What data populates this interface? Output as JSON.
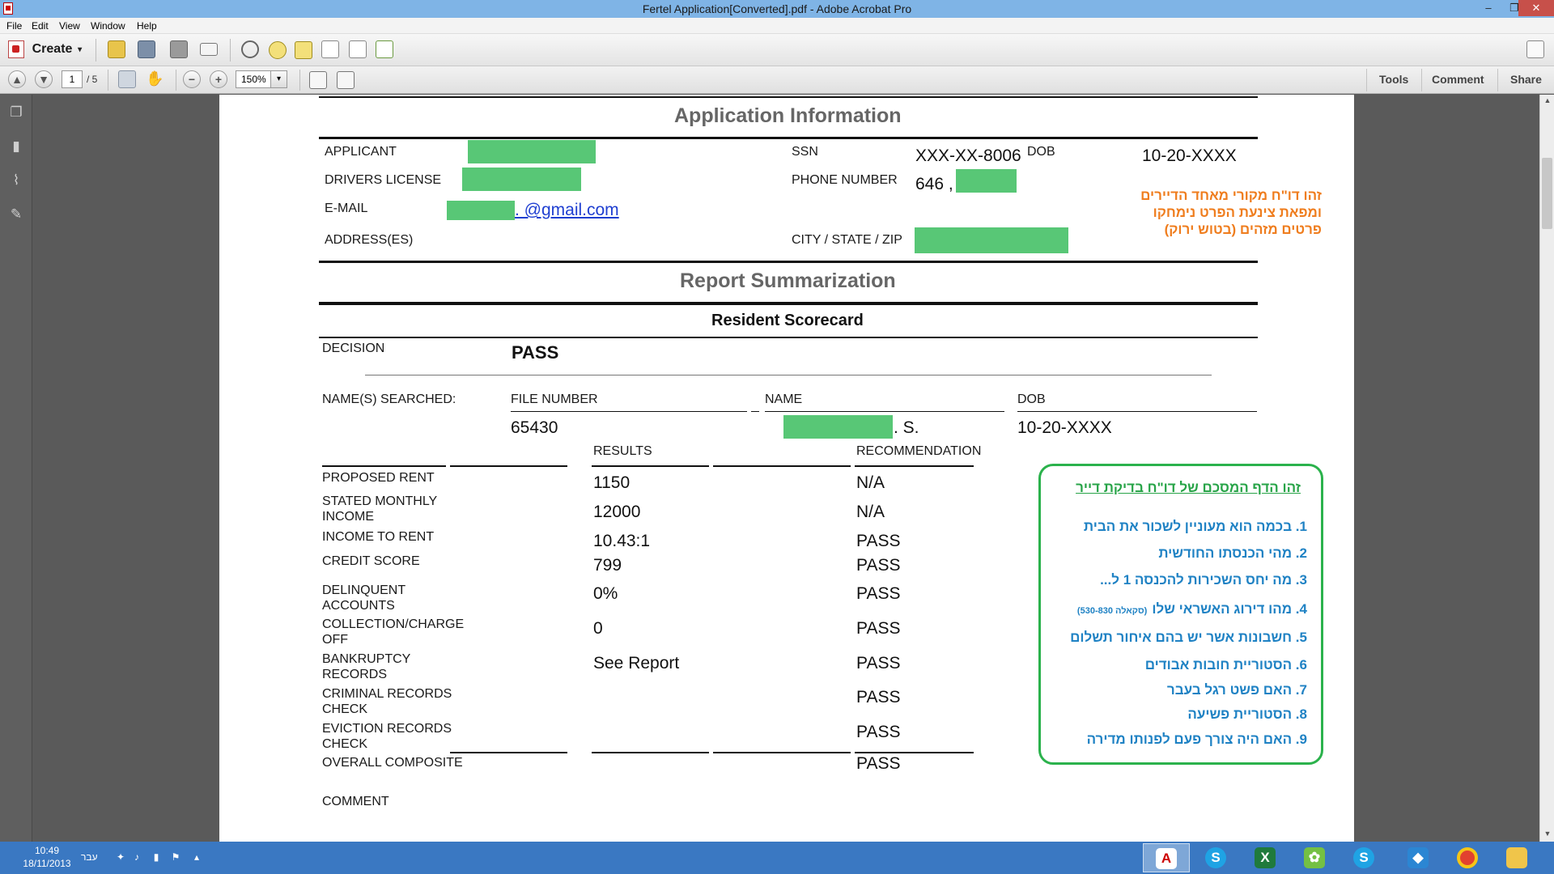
{
  "window": {
    "title": "Fertel Application[Converted].pdf - Adobe Acrobat Pro",
    "controls": {
      "minimize": "–",
      "restore": "❐",
      "close": "✕"
    }
  },
  "menu": [
    "File",
    "Edit",
    "View",
    "Window",
    "Help"
  ],
  "toolbar": {
    "create_label": "Create",
    "create_arrow": "▾",
    "page_current": "1",
    "page_total": "/ 5",
    "zoom": "150%",
    "zoom_arrow": "▾",
    "tabs": [
      "Tools",
      "Comment",
      "Share"
    ]
  },
  "document": {
    "application_information": {
      "heading": "Application Information",
      "labels": {
        "applicant": "APPLICANT",
        "drivers_license": "DRIVERS LICENSE",
        "email": "E-MAIL",
        "address": "ADDRESS(ES)",
        "ssn": "SSN",
        "phone": "PHONE NUMBER",
        "city": "CITY / STATE / ZIP",
        "dob": "DOB"
      },
      "values": {
        "email_suffix": ". @gmail.com",
        "ssn": "XXX-XX-8006",
        "phone_prefix": "646 ,",
        "dob": "10-20-XXXX"
      },
      "note_hebrew": [
        "זהו דו\"ח מקורי מאחד הדיירים",
        "ומפאת צינעת הפרט נימחקו",
        "פרטים מזהים (בטוש ירוק)"
      ]
    },
    "report_summarization": {
      "heading": "Report Summarization",
      "scorecard_title": "Resident Scorecard",
      "decision_label": "DECISION",
      "decision_value": "PASS",
      "names_searched_label": "NAME(S) SEARCHED:",
      "columns": {
        "file_number": "FILE NUMBER",
        "name": "NAME",
        "dob": "DOB"
      },
      "file_number": "65430",
      "name_suffix": ". S.",
      "dob": "10-20-XXXX",
      "results_header": "RESULTS",
      "recommendation_header": "RECOMMENDATION",
      "rows": [
        {
          "label": "PROPOSED RENT",
          "result": "1150",
          "recommendation": "N/A"
        },
        {
          "label": "STATED MONTHLY\nINCOME",
          "result": "12000",
          "recommendation": "N/A"
        },
        {
          "label": "INCOME TO RENT",
          "result": "10.43:1",
          "recommendation": "PASS"
        },
        {
          "label": "CREDIT SCORE",
          "result": "799",
          "recommendation": "PASS"
        },
        {
          "label": "DELINQUENT\nACCOUNTS",
          "result": "0%",
          "recommendation": "PASS"
        },
        {
          "label": "COLLECTION/CHARGE\nOFF",
          "result": "0",
          "recommendation": "PASS"
        },
        {
          "label": "BANKRUPTCY\nRECORDS",
          "result": "See Report",
          "recommendation": "PASS"
        },
        {
          "label": "CRIMINAL RECORDS\nCHECK",
          "result": "",
          "recommendation": "PASS"
        },
        {
          "label": "EVICTION RECORDS\nCHECK",
          "result": "",
          "recommendation": "PASS"
        },
        {
          "label": "OVERALL COMPOSITE",
          "result": "",
          "recommendation": "PASS"
        }
      ],
      "comment_label": "COMMENT"
    },
    "annotation_box": {
      "title": "זהו הדף המסכם של דו\"ח בדיקת דייר",
      "items": [
        "1. בכמה הוא מעוניין לשכור את הבית",
        "2. מהי הכנסתו החודשית",
        "3. מה יחס השכירות להכנסה 1 ל...",
        "4. מהו דירוג האשראי שלו",
        "5. חשבונות אשר יש בהם איחור תשלום",
        "6. הסטוריית חובות אבודים",
        "7. האם פשט רגל בעבר",
        "8. הסטוריית פשיעה",
        "9. האם היה צורך פעם לפנותו מדירה"
      ],
      "item4_note": "(סקאלה 530-830)"
    }
  },
  "taskbar": {
    "time": "10:49",
    "date": "18/11/2013",
    "language": "עבר",
    "apps": [
      "acrobat",
      "skype",
      "excel",
      "app-green",
      "skype-2",
      "dropbox",
      "chrome",
      "explorer"
    ]
  },
  "colors": {
    "redaction_green": "#58c776",
    "annotation_orange": "#ef7d1e",
    "annotation_blue": "#1f82c4",
    "box_green": "#2bb24c",
    "taskbar_blue": "#3a78c2"
  }
}
